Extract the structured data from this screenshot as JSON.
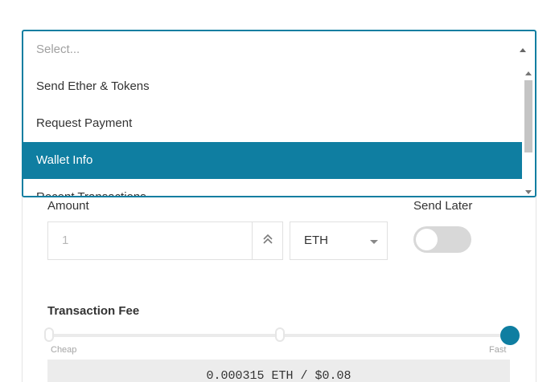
{
  "dropdown": {
    "placeholder": "Select...",
    "items": [
      {
        "label": "Send Ether & Tokens",
        "selected": false
      },
      {
        "label": "Request Payment",
        "selected": false
      },
      {
        "label": "Wallet Info",
        "selected": true
      },
      {
        "label": "Recent Transactions",
        "selected": false
      }
    ]
  },
  "form": {
    "amount_label": "Amount",
    "amount_placeholder": "1",
    "unit": "ETH",
    "send_later_label": "Send Later",
    "send_later_on": false
  },
  "fee": {
    "label": "Transaction Fee",
    "min_caption": "Cheap",
    "max_caption": "Fast",
    "level": 1.0,
    "readout": "0.000315 ETH / $0.08"
  },
  "colors": {
    "accent": "#0f7ea1"
  },
  "icons": {
    "max_button": "double-chevron-up-icon",
    "dropdown_toggle": "caret-up-icon",
    "unit_toggle": "caret-down-icon"
  }
}
